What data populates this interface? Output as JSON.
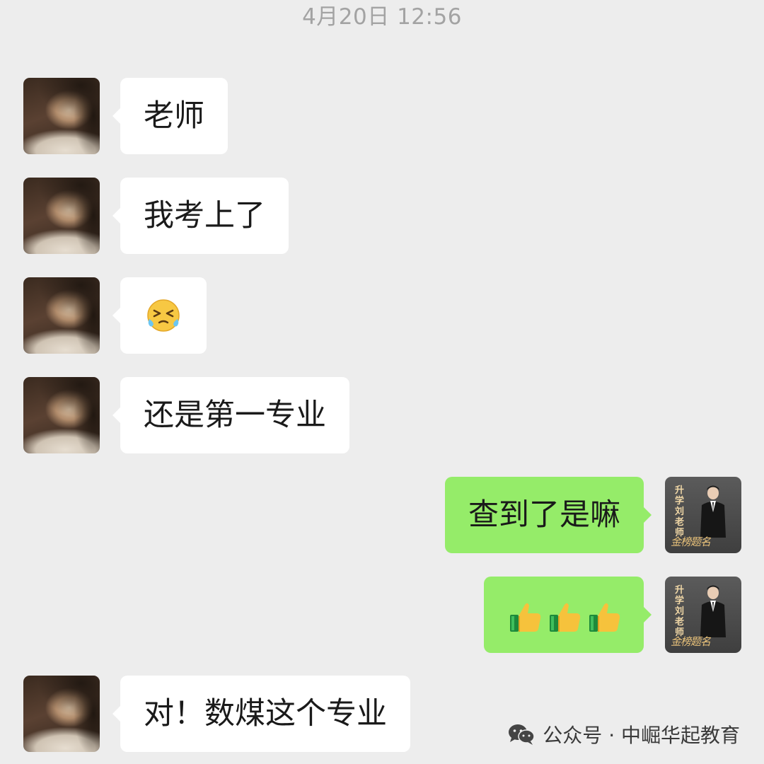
{
  "timestamp": "4月20日 12:56",
  "messages": [
    {
      "side": "left",
      "type": "text",
      "text": "老师"
    },
    {
      "side": "left",
      "type": "text",
      "text": "我考上了"
    },
    {
      "side": "left",
      "type": "emoji",
      "emoji": "squinting-tears-emoji"
    },
    {
      "side": "left",
      "type": "text",
      "text": "还是第一专业"
    },
    {
      "side": "right",
      "type": "text",
      "text": "查到了是嘛"
    },
    {
      "side": "right",
      "type": "emoji",
      "emoji": "thumbs-up-emoji",
      "count": 3
    },
    {
      "side": "left",
      "type": "text",
      "text": "对！数煤这个专业"
    }
  ],
  "teacher_avatar": {
    "tag_text": "升学刘老师",
    "signature_text": "金榜题名"
  },
  "watermark": {
    "icon": "wechat-icon",
    "text": "公众号 · 中崛华起教育"
  },
  "colors": {
    "background": "#ededed",
    "left_bubble": "#ffffff",
    "right_bubble": "#95ec69",
    "timestamp": "#a3a3a3"
  }
}
